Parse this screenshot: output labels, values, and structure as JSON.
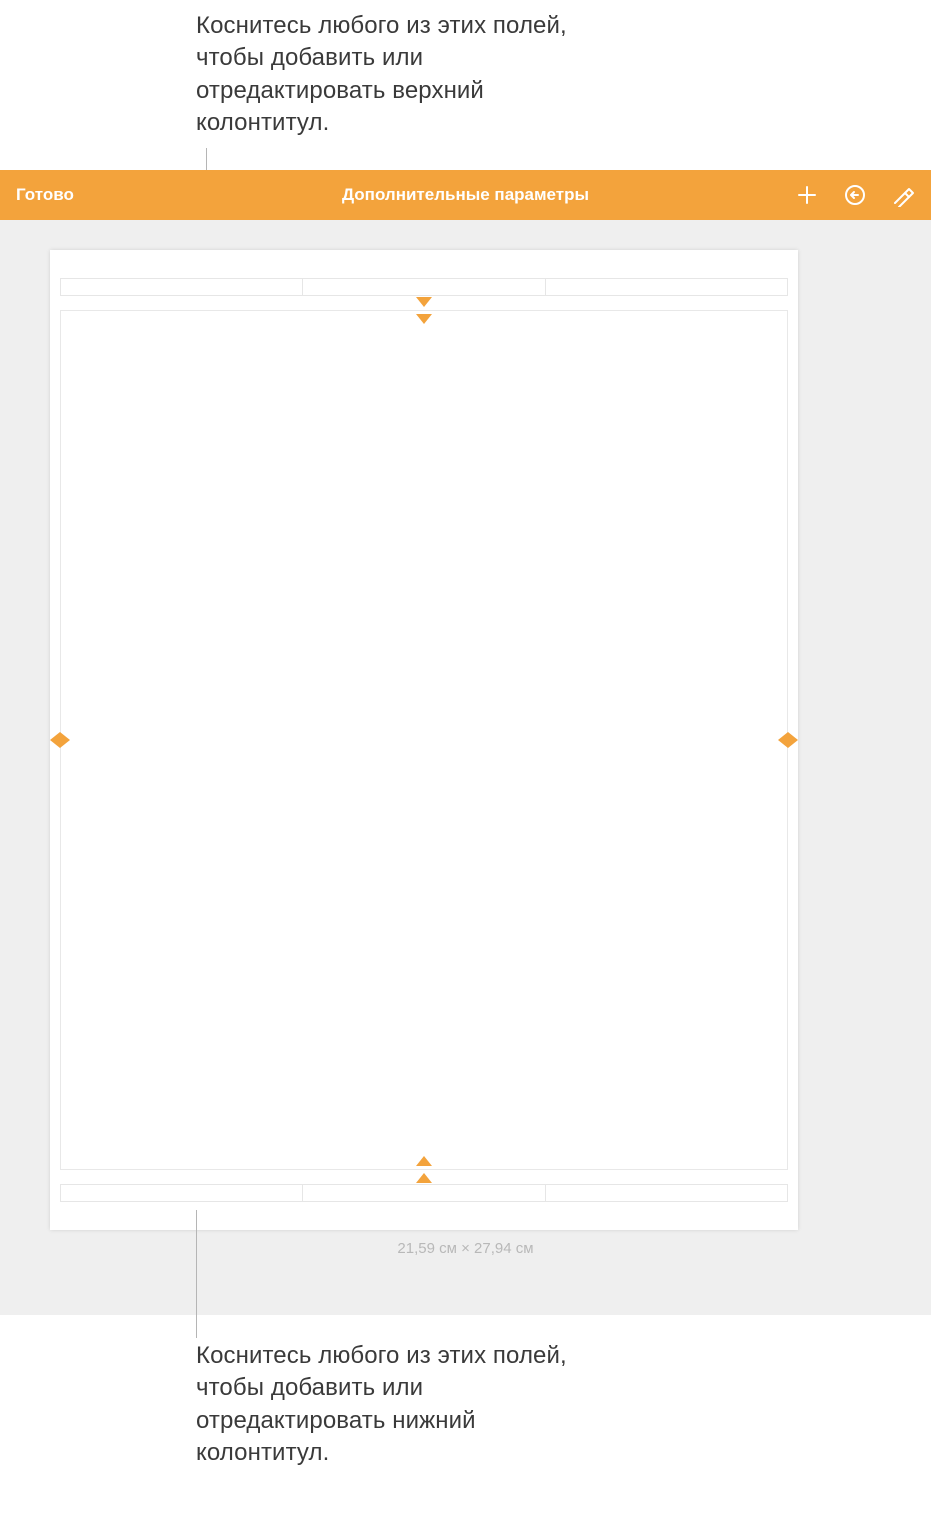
{
  "callouts": {
    "top": "Коснитесь любого из этих полей, чтобы добавить или отредактировать верхний колонтитул.",
    "bottom": "Коснитесь любого из этих полей, чтобы добавить или отредактировать нижний колонтитул."
  },
  "toolbar": {
    "done": "Готово",
    "title": "Дополнительные параметры",
    "icons": {
      "add": "plus",
      "undo": "undo",
      "format": "format-brush"
    }
  },
  "page": {
    "size_label": "21,59 см × 27,94 см"
  }
}
